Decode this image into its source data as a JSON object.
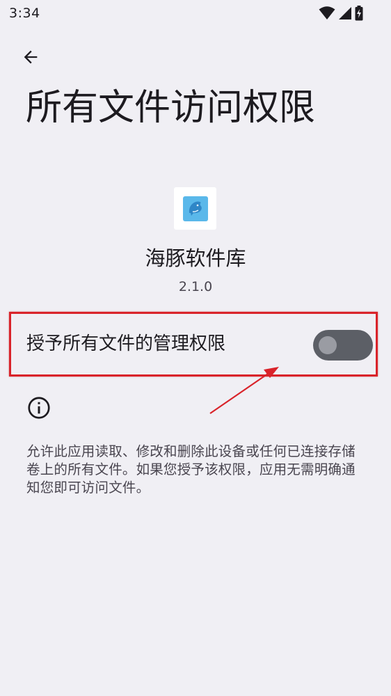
{
  "status_bar": {
    "time": "3:34",
    "icons": [
      "wifi-icon",
      "signal-icon",
      "battery-charging-icon"
    ]
  },
  "header": {
    "back_icon": "arrow-back-icon",
    "title": "所有文件访问权限"
  },
  "app": {
    "icon": "dolphin-app-icon",
    "name": "海豚软件库",
    "version": "2.1.0"
  },
  "permission": {
    "label": "授予所有文件的管理权限",
    "enabled": false
  },
  "info": {
    "icon": "info-icon",
    "description": "允许此应用读取、修改和删除此设备或任何已连接存储卷上的所有文件。如果您授予该权限，应用无需明确通知您即可访问文件。"
  },
  "colors": {
    "background": "#f0eff4",
    "toggle_track_off": "#5c5f66",
    "toggle_thumb_off": "#9a9ca3",
    "annotation_red": "#d9232a"
  }
}
